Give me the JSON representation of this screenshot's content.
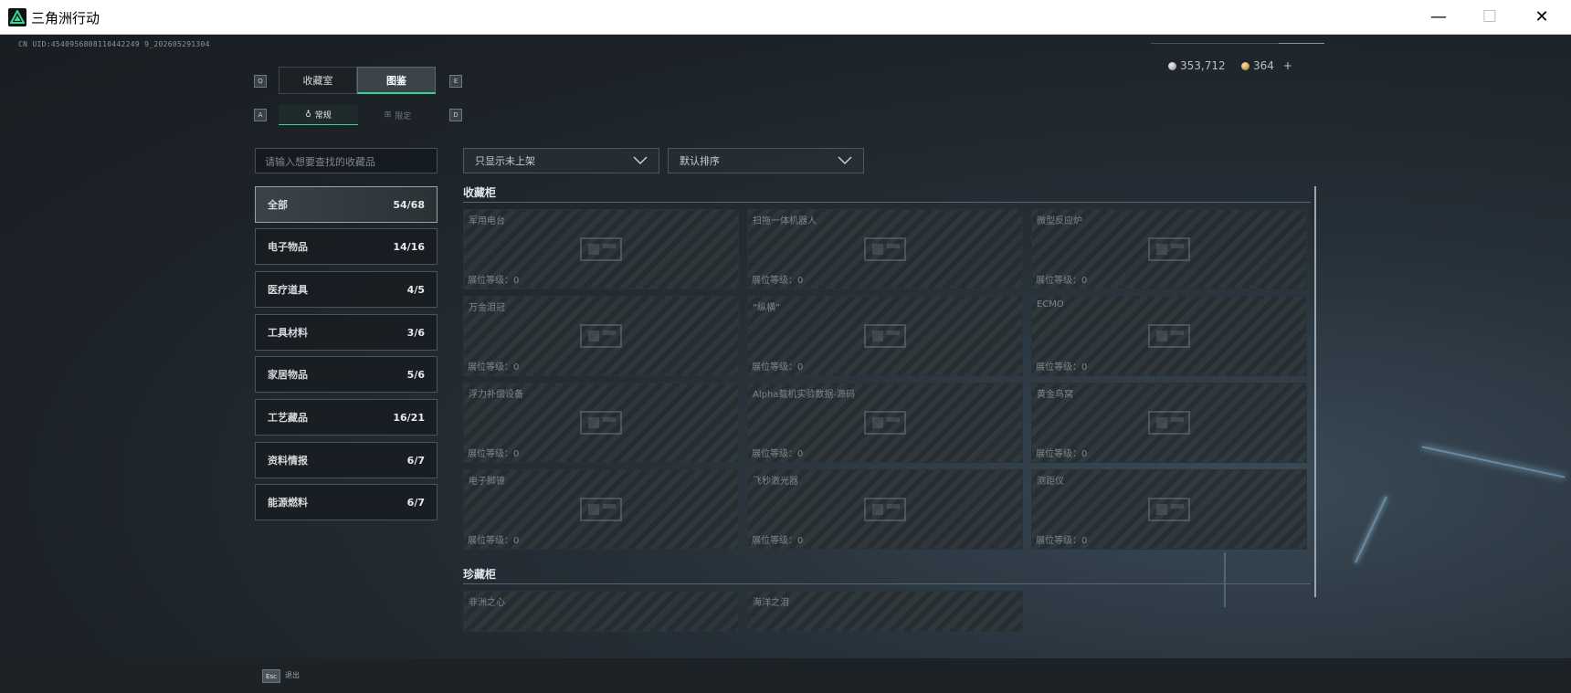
{
  "window": {
    "title": "三角洲行动"
  },
  "uid": "CN UID:4540956808110442249 9_202605291304",
  "currency": {
    "silver": "353,712",
    "gold": "364",
    "gold_add": "+"
  },
  "main_tabs": [
    {
      "label": "收藏室",
      "key": "Q"
    },
    {
      "label": "图鉴",
      "key": "E"
    }
  ],
  "sub_tabs": [
    {
      "label": "常规",
      "key": "A"
    },
    {
      "label": "限定",
      "key": "D"
    }
  ],
  "search": {
    "placeholder": "请输入想要查找的收藏品"
  },
  "categories": [
    {
      "label": "全部",
      "count": "54/68"
    },
    {
      "label": "电子物品",
      "count": "14/16"
    },
    {
      "label": "医疗道具",
      "count": "4/5"
    },
    {
      "label": "工具材料",
      "count": "3/6"
    },
    {
      "label": "家居物品",
      "count": "5/6"
    },
    {
      "label": "工艺藏品",
      "count": "16/21"
    },
    {
      "label": "资料情报",
      "count": "6/7"
    },
    {
      "label": "能源燃料",
      "count": "6/7"
    }
  ],
  "filters": {
    "shelf": "只显示未上架",
    "sort": "默认排序"
  },
  "sections": {
    "cabinet": "收藏柜",
    "treasure": "珍藏柜"
  },
  "cabinet_items": [
    {
      "name": "军用电台",
      "level": "展位等级：0"
    },
    {
      "name": "扫拖一体机器人",
      "level": "展位等级：0"
    },
    {
      "name": "微型反应炉",
      "level": "展位等级：0"
    },
    {
      "name": "万金泪冠",
      "level": "展位等级：0"
    },
    {
      "name": "“纵横”",
      "level": "展位等级：0"
    },
    {
      "name": "ECMO",
      "level": "展位等级：0"
    },
    {
      "name": "浮力补偿设备",
      "level": "展位等级：0"
    },
    {
      "name": "Alpha载机实验数据-源码",
      "level": "展位等级：0"
    },
    {
      "name": "黄金鸟窝",
      "level": "展位等级：0"
    },
    {
      "name": "电子脚镣",
      "level": "展位等级：0"
    },
    {
      "name": "飞秒激光器",
      "level": "展位等级：0"
    },
    {
      "name": "测距仪",
      "level": "展位等级：0"
    }
  ],
  "treasure_items": [
    {
      "name": "非洲之心"
    },
    {
      "name": "海洋之泪"
    }
  ],
  "footer": {
    "esc_key": "Esc",
    "esc_label": "退出"
  },
  "colors": {
    "accent": "#33d691",
    "background": "#1c2228"
  }
}
